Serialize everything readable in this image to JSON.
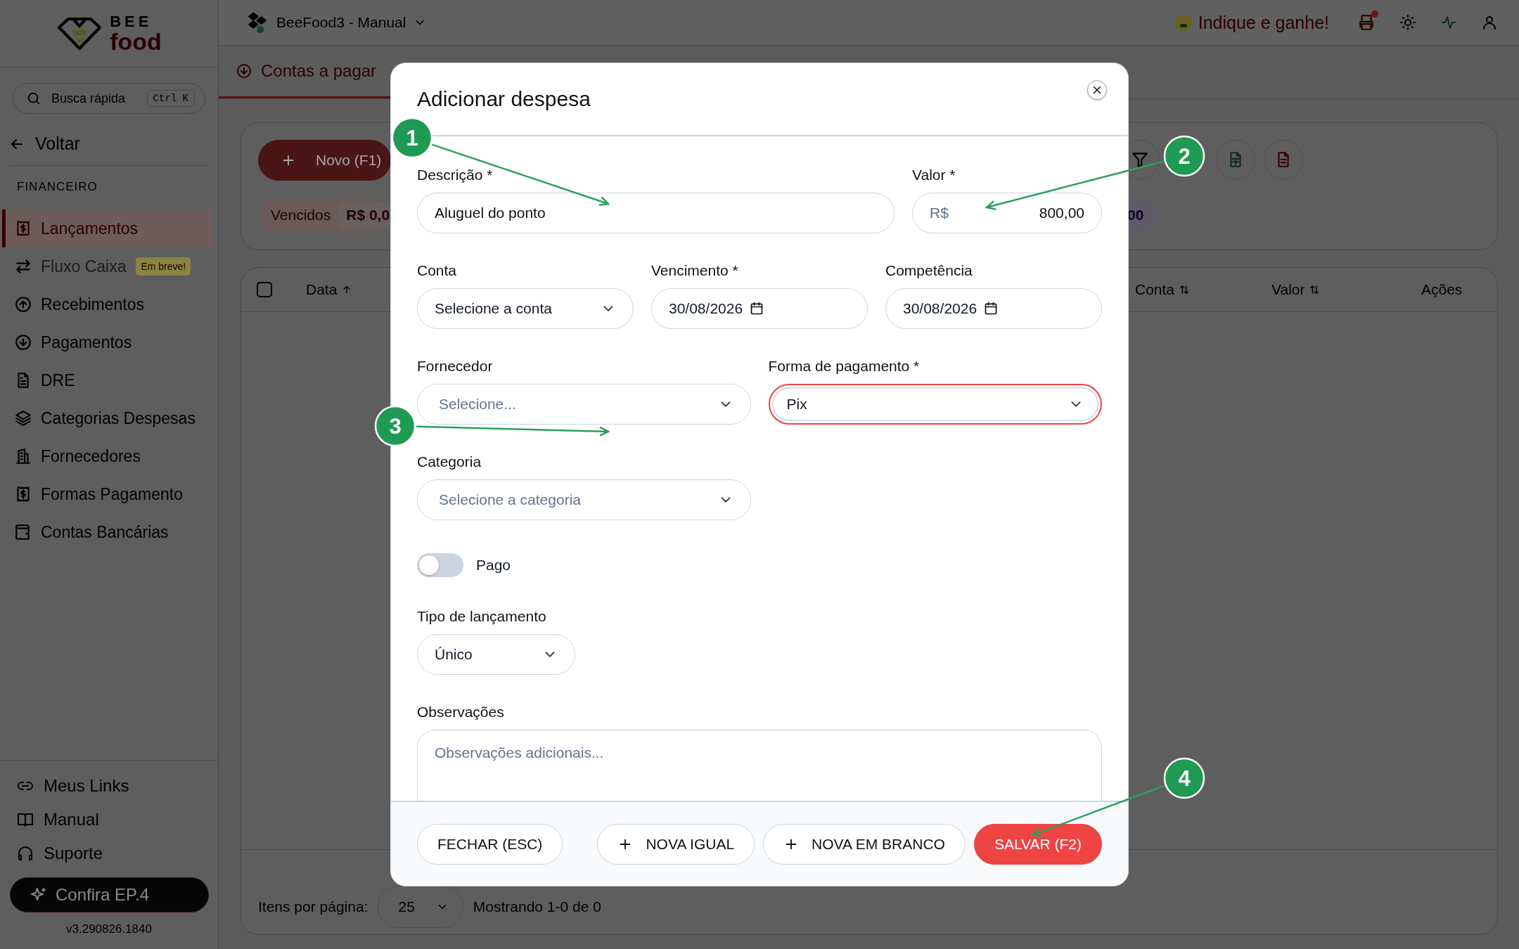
{
  "sidebar": {
    "logo": {
      "line_1": "BEE",
      "line_2": "food"
    },
    "search": {
      "placeholder": "Busca rápida",
      "shortcut": "Ctrl K"
    },
    "back_link": "Voltar",
    "section_title": "FINANCEIRO",
    "items": [
      {
        "label": "Lançamentos",
        "kind": "receipt",
        "selected": true,
        "disabled": false
      },
      {
        "label": "Fluxo Caixa",
        "kind": "swap",
        "selected": false,
        "disabled": true,
        "badge": "Em breve!"
      },
      {
        "label": "Recebimentos",
        "kind": "up",
        "selected": false,
        "disabled": false
      },
      {
        "label": "Pagamentos",
        "kind": "down",
        "selected": false,
        "disabled": false
      },
      {
        "label": "DRE",
        "kind": "file",
        "selected": false,
        "disabled": false
      },
      {
        "label": "Categorias Despesas",
        "kind": "layers",
        "selected": false,
        "disabled": false
      },
      {
        "label": "Fornecedores",
        "kind": "building",
        "selected": false,
        "disabled": false
      },
      {
        "label": "Formas Pagamento",
        "kind": "receipt",
        "selected": false,
        "disabled": false
      },
      {
        "label": "Contas Bancárias",
        "kind": "wallet",
        "selected": false,
        "disabled": false
      }
    ],
    "bottom_links": [
      {
        "label": "Meus Links",
        "kind": "link"
      },
      {
        "label": "Manual",
        "kind": "book"
      },
      {
        "label": "Suporte",
        "kind": "headset"
      }
    ],
    "promo_button": "Confira EP.4",
    "version": "v3.290826.1840"
  },
  "topbar": {
    "workspace": "BeeFood3 - Manual",
    "referral": "Indique e ganhe!",
    "printer_alert": true
  },
  "page": {
    "tab": "Contas a pagar",
    "new_button": "Novo (F1)",
    "summary_chips": [
      {
        "kind": "overdue",
        "label": "Vencidos",
        "value": "R$ 0,0"
      },
      {
        "kind": "total",
        "value": "00"
      }
    ],
    "table": {
      "select_all_checked": false,
      "columns": [
        {
          "label": "Data",
          "sortable": true,
          "sorted": true
        },
        {
          "label": "Conta",
          "sortable": true,
          "sorted": false
        },
        {
          "label": "Valor",
          "sortable": true,
          "sorted": false
        },
        {
          "label": "Ações",
          "sortable": false
        }
      ]
    },
    "pagination": {
      "label": "Itens por página:",
      "page_size": "25",
      "summary": "Mostrando 1-0 de 0"
    }
  },
  "dialog": {
    "title": "Adicionar despesa",
    "fields": [
      {
        "kind": "text",
        "label": "Descrição *",
        "value": "Aluguel do ponto",
        "highlighted": false
      },
      {
        "kind": "money",
        "label": "Valor *",
        "prefix": "R$",
        "value": "800,00",
        "highlighted": false
      },
      {
        "kind": "select",
        "label": "Conta",
        "value": "Selecione a conta",
        "highlighted": false
      },
      {
        "kind": "date",
        "label": "Vencimento *",
        "value": "30/08/2026",
        "highlighted": false
      },
      {
        "kind": "date",
        "label": "Competência",
        "value": "30/08/2026",
        "highlighted": false
      },
      {
        "kind": "select",
        "label": "Fornecedor",
        "placeholder": "Selecione...",
        "highlighted": false
      },
      {
        "kind": "select",
        "label": "Forma de pagamento *",
        "value": "Pix",
        "highlighted": true
      },
      {
        "kind": "select",
        "label": "Categoria",
        "placeholder": "Selecione a categoria",
        "highlighted": false
      },
      {
        "kind": "toggle",
        "label": "Pago",
        "on": false
      },
      {
        "kind": "select",
        "label": "Tipo de lançamento",
        "value": "Único",
        "highlighted": false
      },
      {
        "kind": "textarea",
        "label": "Observações",
        "placeholder": "Observações adicionais...",
        "highlighted": false
      }
    ],
    "buttons": [
      {
        "kind": "secondary",
        "label": "FECHAR (ESC)"
      },
      {
        "kind": "add",
        "label": "NOVA IGUAL"
      },
      {
        "kind": "add",
        "label": "NOVA EM BRANCO"
      },
      {
        "kind": "primary",
        "label": "SALVAR (F2)"
      }
    ]
  },
  "annotations": [
    {
      "label": "1"
    },
    {
      "label": "2"
    },
    {
      "label": "3"
    },
    {
      "label": "4"
    }
  ]
}
